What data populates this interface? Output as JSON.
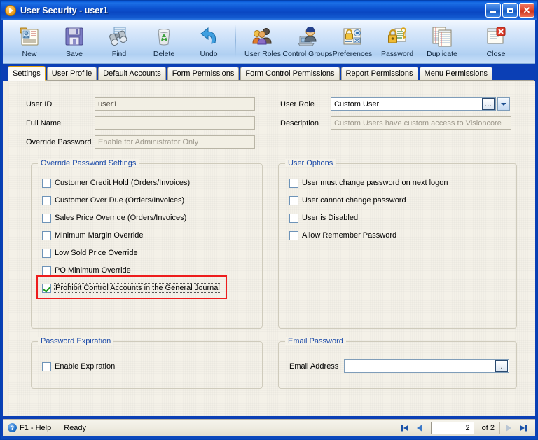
{
  "window": {
    "title": "User Security - user1",
    "app_icon": "play-circle-icon",
    "minimize_label": "Minimize",
    "maximize_label": "Maximize",
    "close_label": "Close"
  },
  "toolbar": {
    "buttons": [
      {
        "label": "New",
        "icon": "new-record-icon"
      },
      {
        "label": "Save",
        "icon": "floppy-disk-icon"
      },
      {
        "label": "Find",
        "icon": "binoculars-icon"
      },
      {
        "label": "Delete",
        "icon": "recycle-bin-icon"
      },
      {
        "label": "Undo",
        "icon": "undo-arrow-icon"
      },
      {
        "label": "User Roles",
        "icon": "users-group-icon"
      },
      {
        "label": "Control Groups",
        "icon": "user-computer-icon"
      },
      {
        "label": "Preferences",
        "icon": "padlock-settings-icon"
      },
      {
        "label": "Password",
        "icon": "padlock-key-icon"
      },
      {
        "label": "Duplicate",
        "icon": "duplicate-pages-icon"
      },
      {
        "label": "Close",
        "icon": "close-document-icon"
      }
    ]
  },
  "tabs": [
    {
      "label": "Settings",
      "active": true
    },
    {
      "label": "User Profile",
      "active": false
    },
    {
      "label": "Default Accounts",
      "active": false
    },
    {
      "label": "Form Permissions",
      "active": false
    },
    {
      "label": "Form Control Permissions",
      "active": false
    },
    {
      "label": "Report Permissions",
      "active": false
    },
    {
      "label": "Menu Permissions",
      "active": false
    }
  ],
  "fields": {
    "user_id": {
      "label": "User ID",
      "value": "user1"
    },
    "full_name": {
      "label": "Full Name",
      "value": ""
    },
    "override_password": {
      "label": "Override Password",
      "value": "Enable for Administrator Only"
    },
    "user_role": {
      "label": "User Role",
      "value": "Custom User",
      "ellipsis": "…",
      "dropdown": "chevron-down-icon"
    },
    "description": {
      "label": "Description",
      "value": "Custom Users have custom access to Visioncore"
    }
  },
  "override_password_settings": {
    "title": "Override Password Settings",
    "items": [
      {
        "label": "Customer Credit Hold (Orders/Invoices)",
        "checked": false,
        "focused": false
      },
      {
        "label": "Customer Over Due (Orders/Invoices)",
        "checked": false,
        "focused": false
      },
      {
        "label": "Sales Price Override (Orders/Invoices)",
        "checked": false,
        "focused": false
      },
      {
        "label": "Minimum Margin Override",
        "checked": false,
        "focused": false
      },
      {
        "label": "Low Sold Price Override",
        "checked": false,
        "focused": false
      },
      {
        "label": "PO Minimum Override",
        "checked": false,
        "focused": false
      },
      {
        "label": "Prohibit Control Accounts in the General Journal",
        "checked": true,
        "focused": true
      }
    ]
  },
  "user_options": {
    "title": "User Options",
    "items": [
      {
        "label": "User must change password on next logon",
        "checked": false
      },
      {
        "label": "User cannot change password",
        "checked": false
      },
      {
        "label": "User is Disabled",
        "checked": false
      },
      {
        "label": "Allow Remember Password",
        "checked": false
      }
    ]
  },
  "password_expiration": {
    "title": "Password Expiration",
    "items": [
      {
        "label": "Enable Expiration",
        "checked": false
      }
    ]
  },
  "email_password": {
    "title": "Email Password",
    "email_label": "Email Address",
    "email_value": "",
    "ellipsis": "…"
  },
  "statusbar": {
    "help_text": "F1 - Help",
    "status_text": "Ready",
    "record_value": "2",
    "of_text": "of  2",
    "first_icon": "first-record-icon",
    "prev_icon": "previous-record-icon",
    "next_icon": "next-record-icon",
    "last_icon": "last-record-icon"
  },
  "colors": {
    "titlebar": "#0c51cf",
    "accent": "#ee1c1c",
    "group_title": "#1a49a8",
    "client_bg": "#f4f1e8"
  }
}
